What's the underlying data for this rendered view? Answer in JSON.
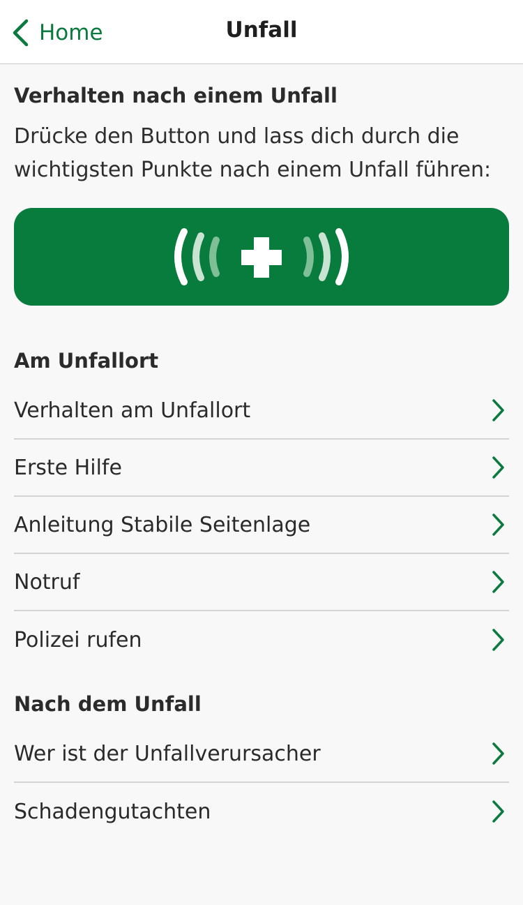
{
  "navbar": {
    "back_label": "Home",
    "title": "Unfall"
  },
  "intro": {
    "heading": "Verhalten nach einem Unfall",
    "text": "Drücke den Button und lass dich durch die wichtigsten Punkte nach einem Unfall führen:"
  },
  "emergency_button": {
    "icon": "emergency-cross-signal-icon"
  },
  "sections": [
    {
      "heading": "Am Unfallort",
      "items": [
        {
          "label": "Verhalten am Unfallort"
        },
        {
          "label": "Erste Hilfe"
        },
        {
          "label": "Anleitung Stabile Seitenlage"
        },
        {
          "label": "Notruf"
        },
        {
          "label": "Polizei rufen"
        }
      ]
    },
    {
      "heading": "Nach dem Unfall",
      "items": [
        {
          "label": "Wer ist der Unfallverursacher"
        },
        {
          "label": "Schadengutachten"
        }
      ]
    }
  ],
  "colors": {
    "accent": "#0a7a3e",
    "button_bg": "#077c3d",
    "background": "#f8f8f8"
  }
}
